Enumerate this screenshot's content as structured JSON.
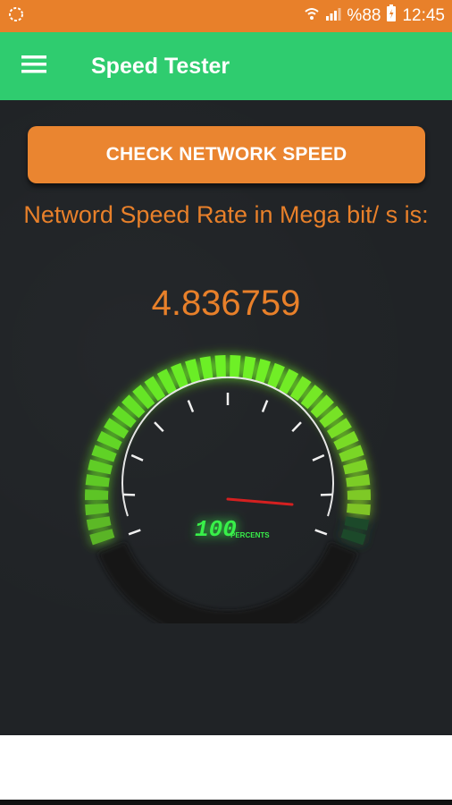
{
  "status_bar": {
    "battery_percent": "%88",
    "time": "12:45",
    "icons": [
      "app-notification-icon",
      "wifi-icon",
      "signal-icon",
      "battery-icon"
    ]
  },
  "app_bar": {
    "title": "Speed Tester",
    "menu_icon": "hamburger-menu-icon"
  },
  "main": {
    "check_button_label": "CHECK NETWORK SPEED",
    "rate_label": "Netword Speed Rate in Mega bit/ s is:",
    "rate_value": "4.836759"
  },
  "gauge": {
    "readout": "100",
    "readout_unit": "PERCENTS",
    "level": 0.95
  },
  "colors": {
    "status_bar": "#e8802a",
    "app_bar": "#2fcc6f",
    "accent": "#e8802a",
    "background": "#202326",
    "gauge_green": "#6fe83a",
    "needle": "#d42020"
  }
}
